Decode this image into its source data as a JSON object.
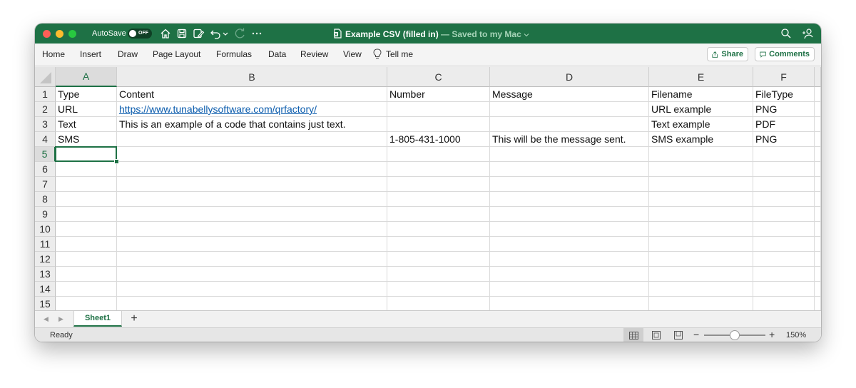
{
  "titlebar": {
    "autosave_label": "AutoSave",
    "autosave_state": "OFF",
    "doc_title": "Example CSV (filled in)",
    "doc_status": " — Saved to my Mac",
    "accent_color": "#1e7145"
  },
  "menubar": {
    "items": [
      "Home",
      "Insert",
      "Draw",
      "Page Layout",
      "Formulas",
      "Data",
      "Review",
      "View"
    ],
    "tell_me": "Tell me",
    "share_label": "Share",
    "comments_label": "Comments"
  },
  "grid": {
    "columns": [
      "A",
      "B",
      "C",
      "D",
      "E",
      "F"
    ],
    "selected_column": "A",
    "selected_row": "5",
    "rows": [
      {
        "num": "1",
        "cells": [
          "Type",
          "Content",
          "Number",
          "Message",
          "Filename",
          "FileType"
        ]
      },
      {
        "num": "2",
        "cells": [
          "URL",
          "https://www.tunabellysoftware.com/qrfactory/",
          "",
          "",
          "URL example",
          "PNG"
        ]
      },
      {
        "num": "3",
        "cells": [
          "Text",
          "This is an example of a code that contains just text.",
          "",
          "",
          "Text example",
          "PDF"
        ]
      },
      {
        "num": "4",
        "cells": [
          "SMS",
          "",
          "1-805-431-1000",
          "This will be the message sent.",
          "SMS example",
          "PNG"
        ]
      },
      {
        "num": "5",
        "cells": [
          "",
          "",
          "",
          "",
          "",
          ""
        ]
      },
      {
        "num": "6",
        "cells": [
          "",
          "",
          "",
          "",
          "",
          ""
        ]
      },
      {
        "num": "7",
        "cells": [
          "",
          "",
          "",
          "",
          "",
          ""
        ]
      },
      {
        "num": "8",
        "cells": [
          "",
          "",
          "",
          "",
          "",
          ""
        ]
      },
      {
        "num": "9",
        "cells": [
          "",
          "",
          "",
          "",
          "",
          ""
        ]
      },
      {
        "num": "10",
        "cells": [
          "",
          "",
          "",
          "",
          "",
          ""
        ]
      },
      {
        "num": "11",
        "cells": [
          "",
          "",
          "",
          "",
          "",
          ""
        ]
      },
      {
        "num": "12",
        "cells": [
          "",
          "",
          "",
          "",
          "",
          ""
        ]
      },
      {
        "num": "13",
        "cells": [
          "",
          "",
          "",
          "",
          "",
          ""
        ]
      },
      {
        "num": "14",
        "cells": [
          "",
          "",
          "",
          "",
          "",
          ""
        ]
      },
      {
        "num": "15",
        "cells": [
          "",
          "",
          "",
          "",
          "",
          ""
        ]
      }
    ]
  },
  "sheets": {
    "active_tab": "Sheet1",
    "add_label": "+"
  },
  "statusbar": {
    "status": "Ready",
    "zoom_minus": "−",
    "zoom_plus": "+",
    "zoom_level": "150%",
    "zoom_fraction": 0.5
  }
}
